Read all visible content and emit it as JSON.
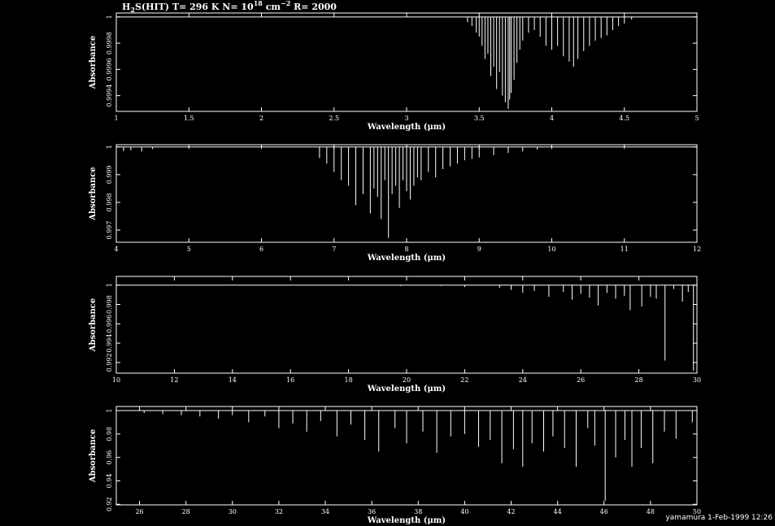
{
  "title": {
    "species": "H",
    "species_sub": "2",
    "species_rest": "S(HIT) T= 296 K N= 10",
    "sup1": "18",
    "unit": " cm",
    "sup2": "−2",
    "rest": " R= 2000"
  },
  "footer": "yamamura  1-Feb-1999 12:26",
  "colors": {
    "background": "#000000",
    "foreground": "#ffffff"
  },
  "chart_data": [
    {
      "type": "line",
      "xlabel": "Wavelength (μm)",
      "ylabel": "Absorbance",
      "xlim": [
        1,
        5
      ],
      "ylim": [
        0.99928,
        1.00003
      ],
      "xticks": [
        1,
        1.5,
        2,
        2.5,
        3,
        3.5,
        4,
        4.5,
        5
      ],
      "xtick_labels": [
        "1",
        "1.5",
        "2",
        "2.5",
        "3",
        "3.5",
        "4",
        "4.5",
        "5"
      ],
      "yticks": [
        1,
        0.9998,
        0.9996,
        0.9994
      ],
      "ytick_labels": [
        "1",
        "0.9998",
        "0.9996",
        "0.9994"
      ],
      "lines": [
        [
          3.42,
          0.99996
        ],
        [
          3.45,
          0.99993
        ],
        [
          3.48,
          0.99988
        ],
        [
          3.5,
          0.99985
        ],
        [
          3.52,
          0.99978
        ],
        [
          3.54,
          0.99968
        ],
        [
          3.56,
          0.99972
        ],
        [
          3.58,
          0.99955
        ],
        [
          3.6,
          0.99962
        ],
        [
          3.62,
          0.99945
        ],
        [
          3.64,
          0.99958
        ],
        [
          3.66,
          0.9994
        ],
        [
          3.68,
          0.99935
        ],
        [
          3.7,
          0.9993
        ],
        [
          3.71,
          0.99937
        ],
        [
          3.72,
          0.99942
        ],
        [
          3.74,
          0.99952
        ],
        [
          3.76,
          0.99965
        ],
        [
          3.78,
          0.99975
        ],
        [
          3.8,
          0.99982
        ],
        [
          3.84,
          0.99988
        ],
        [
          3.88,
          0.9999
        ],
        [
          3.92,
          0.99985
        ],
        [
          3.96,
          0.99978
        ],
        [
          4.0,
          0.99975
        ],
        [
          4.04,
          0.99978
        ],
        [
          4.08,
          0.9997
        ],
        [
          4.12,
          0.99966
        ],
        [
          4.15,
          0.99962
        ],
        [
          4.18,
          0.99968
        ],
        [
          4.22,
          0.99974
        ],
        [
          4.26,
          0.99978
        ],
        [
          4.3,
          0.99982
        ],
        [
          4.34,
          0.99984
        ],
        [
          4.38,
          0.99986
        ],
        [
          4.42,
          0.9999
        ],
        [
          4.46,
          0.99993
        ],
        [
          4.5,
          0.99995
        ],
        [
          4.55,
          0.99998
        ]
      ]
    },
    {
      "type": "line",
      "xlabel": "Wavelength (μm)",
      "ylabel": "Absorbance",
      "xlim": [
        4,
        12
      ],
      "ylim": [
        0.99656,
        1.00008
      ],
      "xticks": [
        4,
        5,
        6,
        7,
        8,
        9,
        10,
        11,
        12
      ],
      "xtick_labels": [
        "4",
        "5",
        "6",
        "7",
        "8",
        "9",
        "10",
        "11",
        "12"
      ],
      "yticks": [
        1,
        0.999,
        0.998,
        0.997
      ],
      "ytick_labels": [
        "1",
        "0.999",
        "0.998",
        "0.997"
      ],
      "lines": [
        [
          4.1,
          0.99985
        ],
        [
          4.2,
          0.99988
        ],
        [
          4.35,
          0.99983
        ],
        [
          4.5,
          0.99992
        ],
        [
          6.8,
          0.9996
        ],
        [
          6.9,
          0.9994
        ],
        [
          7.0,
          0.9991
        ],
        [
          7.1,
          0.9988
        ],
        [
          7.2,
          0.9986
        ],
        [
          7.3,
          0.9979
        ],
        [
          7.4,
          0.9983
        ],
        [
          7.5,
          0.9976
        ],
        [
          7.55,
          0.9985
        ],
        [
          7.6,
          0.9982
        ],
        [
          7.65,
          0.9974
        ],
        [
          7.7,
          0.9988
        ],
        [
          7.75,
          0.99672
        ],
        [
          7.8,
          0.9983
        ],
        [
          7.85,
          0.9986
        ],
        [
          7.9,
          0.9978
        ],
        [
          7.95,
          0.9988
        ],
        [
          8.0,
          0.9984
        ],
        [
          8.05,
          0.9981
        ],
        [
          8.1,
          0.9986
        ],
        [
          8.15,
          0.9989
        ],
        [
          8.2,
          0.9988
        ],
        [
          8.3,
          0.9991
        ],
        [
          8.4,
          0.9989
        ],
        [
          8.5,
          0.9992
        ],
        [
          8.6,
          0.9993
        ],
        [
          8.7,
          0.9994
        ],
        [
          8.8,
          0.99952
        ],
        [
          8.9,
          0.99957
        ],
        [
          9.0,
          0.99962
        ],
        [
          9.2,
          0.9997
        ],
        [
          9.4,
          0.99978
        ],
        [
          9.6,
          0.99984
        ],
        [
          9.8,
          0.9999
        ],
        [
          10.0,
          0.99993
        ]
      ]
    },
    {
      "type": "line",
      "xlabel": "Wavelength (μm)",
      "ylabel": "Absorbance",
      "xlim": [
        10,
        30
      ],
      "ylim": [
        0.9909,
        1.0009
      ],
      "xticks": [
        10,
        12,
        14,
        16,
        18,
        20,
        22,
        24,
        26,
        28,
        30
      ],
      "xtick_labels": [
        "10",
        "12",
        "14",
        "16",
        "18",
        "20",
        "22",
        "24",
        "26",
        "28",
        "30"
      ],
      "yticks": [
        1,
        0.998,
        0.996,
        0.994,
        0.992
      ],
      "ytick_labels": [
        "1",
        "0.998",
        "0.996",
        "0.994",
        "0.992"
      ],
      "lines": [
        [
          19.8,
          0.9999
        ],
        [
          21.2,
          0.9999
        ],
        [
          22.0,
          0.9998
        ],
        [
          23.2,
          0.9997
        ],
        [
          23.6,
          0.9995
        ],
        [
          24.0,
          0.9992
        ],
        [
          24.4,
          0.9994
        ],
        [
          24.9,
          0.9988
        ],
        [
          25.4,
          0.9993
        ],
        [
          25.7,
          0.9985
        ],
        [
          26.0,
          0.9991
        ],
        [
          26.3,
          0.9987
        ],
        [
          26.6,
          0.9979
        ],
        [
          26.9,
          0.9992
        ],
        [
          27.2,
          0.9986
        ],
        [
          27.5,
          0.9989
        ],
        [
          27.7,
          0.9974
        ],
        [
          28.1,
          0.9978
        ],
        [
          28.4,
          0.9988
        ],
        [
          28.6,
          0.9986
        ],
        [
          28.9,
          0.9922
        ],
        [
          29.2,
          0.9996
        ],
        [
          29.5,
          0.9983
        ],
        [
          29.7,
          0.9993
        ],
        [
          29.88,
          0.99115
        ]
      ]
    },
    {
      "type": "line",
      "xlabel": "Wavelength (μm)",
      "ylabel": "Absorbance",
      "xlim": [
        25,
        50
      ],
      "ylim": [
        0.9195,
        1.0035
      ],
      "xticks": [
        26,
        28,
        30,
        32,
        34,
        36,
        38,
        40,
        42,
        44,
        46,
        48,
        50
      ],
      "xtick_labels": [
        "26",
        "28",
        "30",
        "32",
        "34",
        "36",
        "38",
        "40",
        "42",
        "44",
        "46",
        "48",
        "50"
      ],
      "yticks": [
        1,
        0.98,
        0.96,
        0.94,
        0.92
      ],
      "ytick_labels": [
        "1",
        "0.98",
        "0.96",
        "0.94",
        "0.92"
      ],
      "lines": [
        [
          26.2,
          0.998
        ],
        [
          27.0,
          0.997
        ],
        [
          27.8,
          0.996
        ],
        [
          28.6,
          0.995
        ],
        [
          29.4,
          0.993
        ],
        [
          30.0,
          0.996
        ],
        [
          30.7,
          0.99
        ],
        [
          31.4,
          0.995
        ],
        [
          32.0,
          0.985
        ],
        [
          32.6,
          0.989
        ],
        [
          33.2,
          0.982
        ],
        [
          33.8,
          0.991
        ],
        [
          34.5,
          0.978
        ],
        [
          35.1,
          0.988
        ],
        [
          35.7,
          0.975
        ],
        [
          36.3,
          0.965
        ],
        [
          37.0,
          0.985
        ],
        [
          37.5,
          0.972
        ],
        [
          38.2,
          0.982
        ],
        [
          38.8,
          0.964
        ],
        [
          39.4,
          0.978
        ],
        [
          40.0,
          0.98
        ],
        [
          40.6,
          0.969
        ],
        [
          41.1,
          0.975
        ],
        [
          41.6,
          0.955
        ],
        [
          42.1,
          0.967
        ],
        [
          42.5,
          0.952
        ],
        [
          42.9,
          0.972
        ],
        [
          43.4,
          0.965
        ],
        [
          43.8,
          0.978
        ],
        [
          44.3,
          0.968
        ],
        [
          44.8,
          0.952
        ],
        [
          45.3,
          0.985
        ],
        [
          45.6,
          0.97
        ],
        [
          46.05,
          0.923
        ],
        [
          46.5,
          0.96
        ],
        [
          46.9,
          0.975
        ],
        [
          47.2,
          0.952
        ],
        [
          47.6,
          0.968
        ],
        [
          48.1,
          0.955
        ],
        [
          48.6,
          0.982
        ],
        [
          49.1,
          0.976
        ],
        [
          49.8,
          0.99
        ]
      ]
    }
  ]
}
